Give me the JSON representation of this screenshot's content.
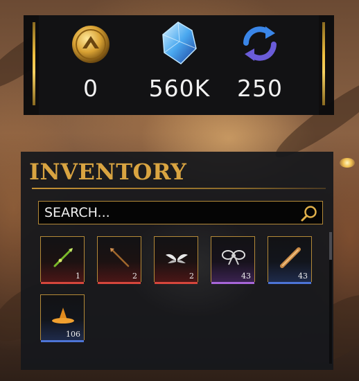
{
  "currencies": [
    {
      "icon": "gold-coin-icon",
      "value": "0"
    },
    {
      "icon": "blue-crystal-icon",
      "value": "560K"
    },
    {
      "icon": "refresh-token-icon",
      "value": "250"
    }
  ],
  "inventory": {
    "title": "INVENTORY",
    "search_placeholder": "SEARCH...",
    "items": [
      {
        "icon": "green-spear-icon",
        "count": "1",
        "rarity": "red"
      },
      {
        "icon": "bronze-spear-icon",
        "count": "2",
        "rarity": "red"
      },
      {
        "icon": "white-wings-icon",
        "count": "2",
        "rarity": "red"
      },
      {
        "icon": "ribbon-bow-icon",
        "count": "43",
        "rarity": "purple"
      },
      {
        "icon": "wooden-scroll-icon",
        "count": "43",
        "rarity": "blue"
      },
      {
        "icon": "orange-hat-icon",
        "count": "106",
        "rarity": "blue"
      }
    ]
  },
  "colors": {
    "gold_accent": "#d9a441",
    "rarity_red": "#d6463c",
    "rarity_purple": "#a766d8",
    "rarity_blue": "#4d74d6"
  }
}
